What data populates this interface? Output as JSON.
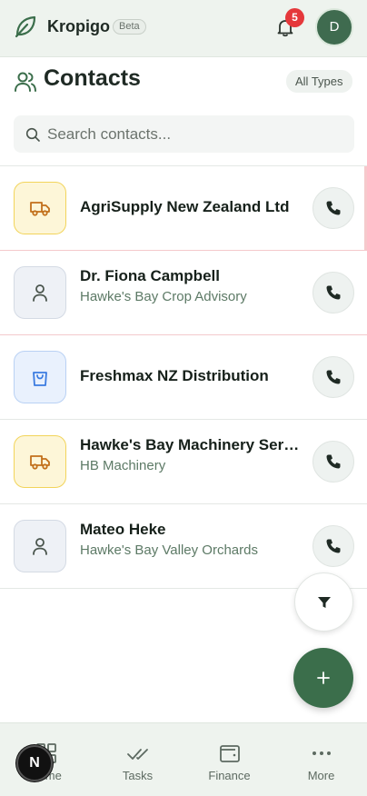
{
  "header": {
    "brand_name": "Kropigo",
    "beta_label": "Beta",
    "notification_count": "5",
    "avatar_initial": "D"
  },
  "page": {
    "title": "Contacts",
    "type_filter": "All Types"
  },
  "search": {
    "placeholder": "Search contacts...",
    "value": ""
  },
  "contacts": [
    {
      "name": "AgriSupply New Zealand Ltd",
      "subtitle": "",
      "icon": "truck-icon"
    },
    {
      "name": "Dr. Fiona Campbell",
      "subtitle": "Hawke's Bay Crop Advisory",
      "icon": "person-icon"
    },
    {
      "name": "Freshmax NZ Distribution",
      "subtitle": "",
      "icon": "shopping-bag-icon"
    },
    {
      "name": "Hawke's Bay Machinery Services",
      "subtitle": "HB Machinery",
      "icon": "truck-icon"
    },
    {
      "name": "Mateo Heke",
      "subtitle": "Hawke's Bay Valley Orchards",
      "icon": "person-icon"
    }
  ],
  "fab": {
    "filter_icon": "filter-icon",
    "add_label": "+"
  },
  "nav": {
    "items": [
      {
        "label": "Home",
        "icon": "grid-icon"
      },
      {
        "label": "Tasks",
        "icon": "checks-icon"
      },
      {
        "label": "Finance",
        "icon": "wallet-icon"
      },
      {
        "label": "More",
        "icon": "dots-icon"
      }
    ]
  },
  "dev_badge": "N",
  "colors": {
    "brand": "#3b6e4b",
    "header_bg": "#eef3ee",
    "notification": "#e5383b",
    "supplier_tile": "#fdf6d8",
    "buyer_tile": "#e9f1fd",
    "subtitle_text": "#5d7a66"
  }
}
